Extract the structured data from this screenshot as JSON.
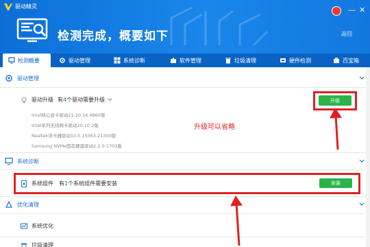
{
  "window": {
    "app_name": "驱动精灵",
    "minimize": "—",
    "close": "✕"
  },
  "header": {
    "headline": "检测完成，概要如下",
    "back_label": "返回"
  },
  "tabs": [
    {
      "label": "检测概要",
      "icon": "summary-icon"
    },
    {
      "label": "驱动管理",
      "icon": "gear-icon"
    },
    {
      "label": "系统诊断",
      "icon": "windows-icon"
    },
    {
      "label": "软件管理",
      "icon": "puzzle-icon"
    },
    {
      "label": "垃圾清理",
      "icon": "trash-icon"
    },
    {
      "label": "硬件检测",
      "icon": "chip-icon"
    },
    {
      "label": "百宝箱",
      "icon": "toolbox-icon"
    }
  ],
  "sections": {
    "driver": {
      "title": "驱动管理",
      "row_label": "驱动升级",
      "row_prefix": "有",
      "row_count": "4",
      "row_suffix": "个驱动需要升级",
      "items": [
        "Intel核心显卡驱动21.20.16.4860版",
        "Intel系列无线网卡驱动20.10.2版",
        "Realtek读卡器驱动10.0.15063.21300版",
        "Samsung NVMe固态硬盘驱动2.2.0.1703版"
      ],
      "button": "升级",
      "annotation": "升级可以省略"
    },
    "system": {
      "title": "系统诊断",
      "row_label": "系统组件",
      "row_prefix": "有",
      "row_count": "1",
      "row_suffix": "个系统组件需要安装",
      "button": "安装"
    },
    "optimize": {
      "title": "优化清理",
      "row1": "系统优化",
      "row2": "垃圾清理"
    }
  },
  "colors": {
    "brand_blue": "#1a86ea",
    "tab_bar": "#0a62c4",
    "green": "#2bb34a",
    "annotation_red": "#e02020"
  }
}
